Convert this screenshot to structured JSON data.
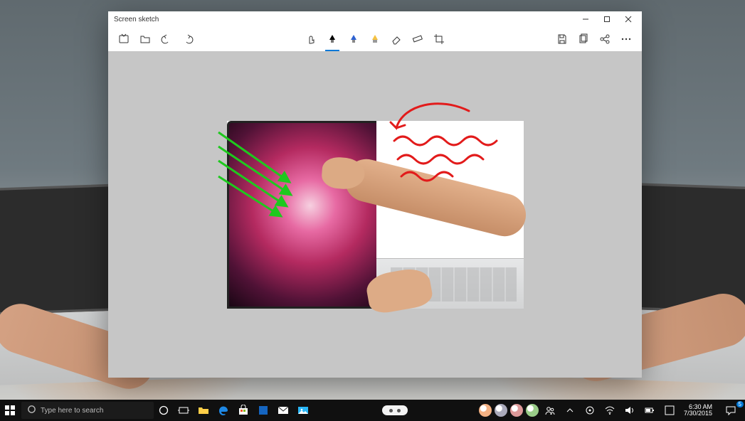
{
  "window": {
    "title": "Screen sketch",
    "controls": {
      "minimize": "Minimize",
      "maximize": "Maximize",
      "close": "Close"
    }
  },
  "toolbar": {
    "left": {
      "new": "New",
      "open": "Open",
      "undo": "Undo",
      "redo": "Redo"
    },
    "center": {
      "touch_writing": "Touch writing",
      "ballpoint": "Ballpoint pen",
      "pencil": "Pencil",
      "highlighter": "Highlighter",
      "eraser": "Eraser",
      "ruler": "Ruler",
      "crop": "Crop",
      "selected": "ballpoint",
      "pen_colors": {
        "ballpoint": "#000000",
        "pencil": "#2d61d1",
        "highlighter": "#f5c242"
      }
    },
    "right": {
      "save": "Save as",
      "copy": "Copy",
      "share": "Share",
      "more": "See more"
    }
  },
  "annotations": {
    "green_arrows": {
      "color": "#1ec91e",
      "count": 4,
      "direction": "down-right"
    },
    "red_ink": {
      "color": "#e21b1b",
      "curved_arrow": true,
      "squiggles": 3
    }
  },
  "taskbar": {
    "start": "Start",
    "search_placeholder": "Type here to search",
    "items": {
      "cortana": "Cortana",
      "task_view": "Task View",
      "file_explorer": "File Explorer",
      "edge": "Microsoft Edge",
      "store": "Microsoft Store",
      "app1": "App",
      "mail": "Mail",
      "photos": "Photos"
    },
    "tray": {
      "people": "People",
      "up": "Show hidden icons",
      "location": "Location",
      "wifi": "Network",
      "volume": "Volume",
      "power": "Power",
      "ime": "IME"
    },
    "clock": {
      "time": "6:30 AM",
      "date": "7/30/2015"
    },
    "notification_count": "5"
  }
}
